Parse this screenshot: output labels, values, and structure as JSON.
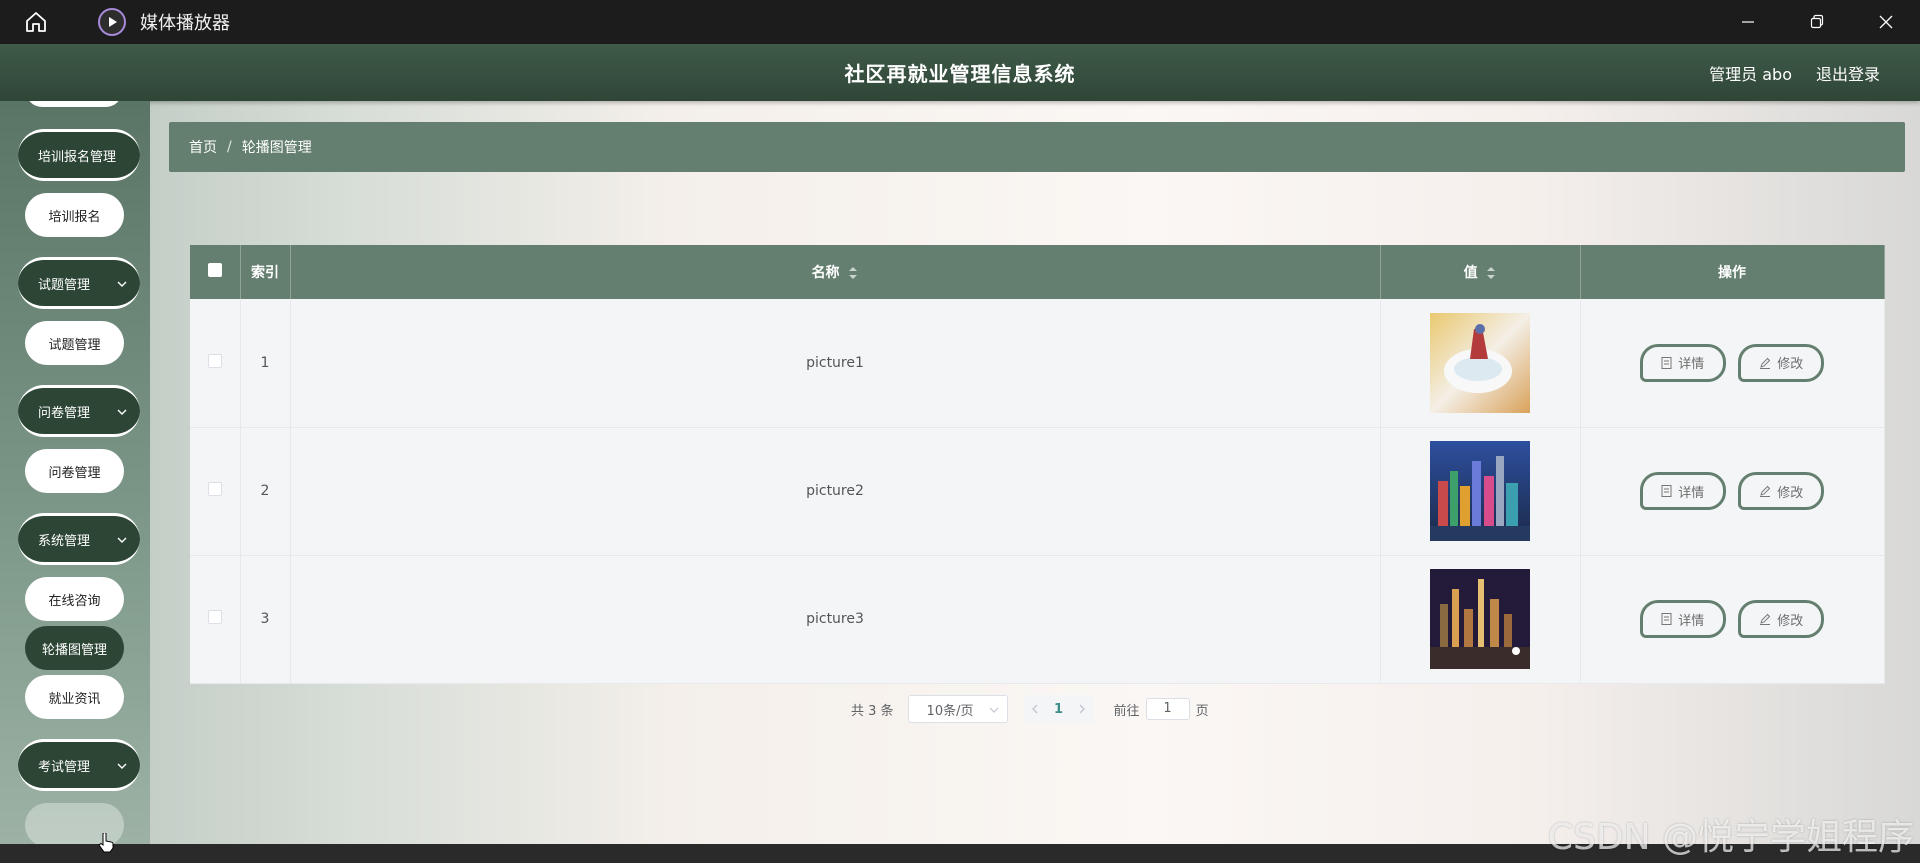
{
  "window": {
    "title": "媒体播放器"
  },
  "header": {
    "title": "社区再就业管理信息系统",
    "user": "管理员 abo",
    "logout": "退出登录"
  },
  "sidebar": {
    "groups": [
      {
        "label": "培训报名管理",
        "item": "培训报名"
      },
      {
        "label": "试题管理",
        "item": "试题管理"
      },
      {
        "label": "问卷管理",
        "item": "问卷管理"
      },
      {
        "label": "系统管理",
        "items": [
          "在线咨询",
          "轮播图管理",
          "就业资讯"
        ]
      },
      {
        "label": "考试管理"
      }
    ],
    "active_item": "轮播图管理"
  },
  "breadcrumb": {
    "home": "首页",
    "separator": "/",
    "current": "轮播图管理"
  },
  "table": {
    "headers": {
      "index": "索引",
      "name": "名称",
      "value": "值",
      "actions": "操作"
    },
    "rows": [
      {
        "index": "1",
        "name": "picture1",
        "detail": "详情",
        "edit": "修改"
      },
      {
        "index": "2",
        "name": "picture2",
        "detail": "详情",
        "edit": "修改"
      },
      {
        "index": "3",
        "name": "picture3",
        "detail": "详情",
        "edit": "修改"
      }
    ]
  },
  "pagination": {
    "total": "共 3 条",
    "page_size": "10条/页",
    "current": "1",
    "goto_prefix": "前往",
    "goto_value": "1",
    "goto_suffix": "页"
  },
  "watermark": "CSDN @悦宁学姐程序",
  "colors": {
    "primary": "#647f6f",
    "header": "#2f4637",
    "menu_dark": "#2c4535",
    "accent": "#3e8e8a"
  }
}
